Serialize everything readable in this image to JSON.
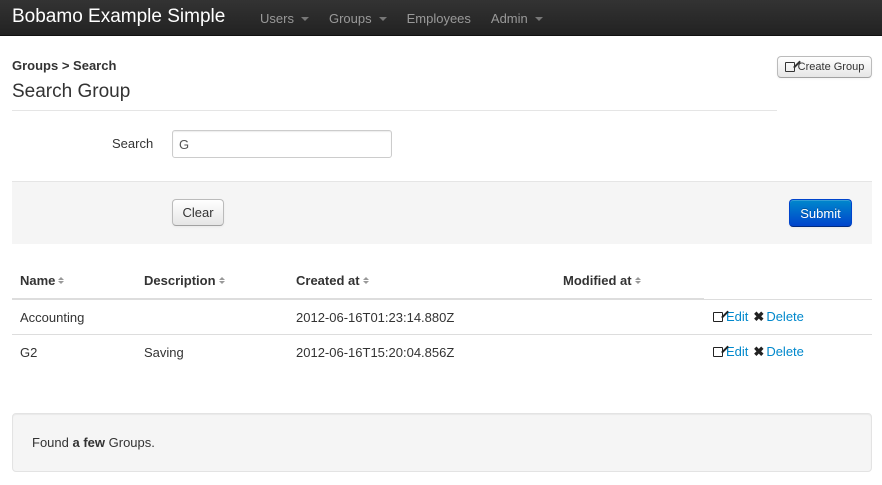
{
  "navbar": {
    "brand": "Bobamo Example Simple",
    "items": [
      {
        "label": "Users",
        "dropdown": true
      },
      {
        "label": "Groups",
        "dropdown": true
      },
      {
        "label": "Employees",
        "dropdown": false
      },
      {
        "label": "Admin",
        "dropdown": true
      }
    ]
  },
  "header": {
    "breadcrumb": "Groups > Search",
    "title": "Search Group",
    "create_button": "Create Group"
  },
  "form": {
    "search_label": "Search",
    "search_value": "G",
    "clear_label": "Clear",
    "submit_label": "Submit"
  },
  "table": {
    "columns": [
      "Name",
      "Description",
      "Created at",
      "Modified at"
    ],
    "rows": [
      {
        "name": "Accounting",
        "description": "",
        "created_at": "2012-06-16T01:23:14.880Z",
        "modified_at": ""
      },
      {
        "name": "G2",
        "description": "Saving",
        "created_at": "2012-06-16T15:20:04.856Z",
        "modified_at": ""
      }
    ],
    "edit_label": "Edit",
    "delete_label": "Delete"
  },
  "result": {
    "prefix": "Found",
    "emphasis": "a few",
    "suffix": "Groups."
  },
  "colors": {
    "navbar": "#222222",
    "link": "#0088cc",
    "primary_button": "#0055cc"
  }
}
